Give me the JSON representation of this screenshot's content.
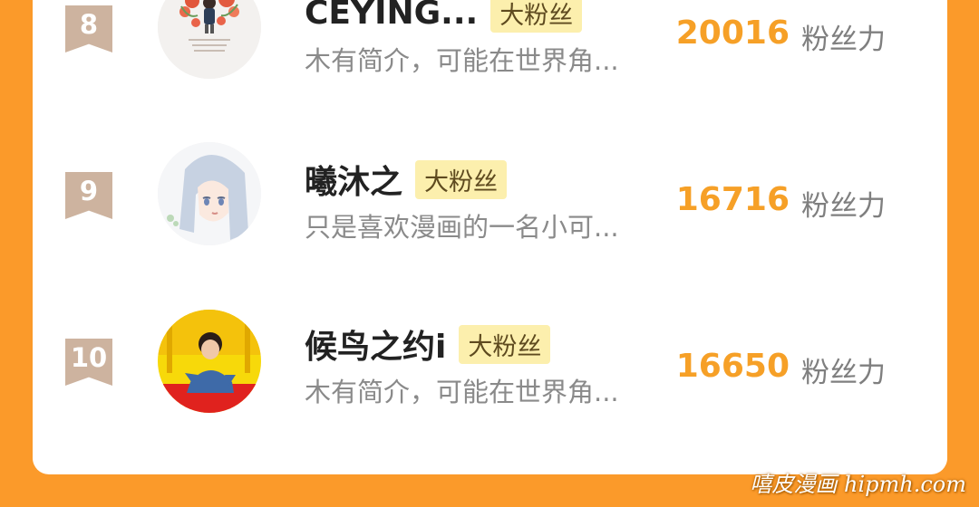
{
  "ranking": [
    {
      "rank": "8",
      "name": "CEYING...",
      "badge": "大粉丝",
      "intro": "木有简介，可能在世界角...",
      "score": "20016",
      "score_unit": "粉丝力",
      "avatar_icon": "flower-girl-avatar"
    },
    {
      "rank": "9",
      "name": "曦沐之",
      "badge": "大粉丝",
      "intro": "只是喜欢漫画的一名小可...",
      "score": "16716",
      "score_unit": "粉丝力",
      "avatar_icon": "anime-girl-avatar"
    },
    {
      "rank": "10",
      "name": "候鸟之约i",
      "badge": "大粉丝",
      "intro": "木有简介，可能在世界角...",
      "score": "16650",
      "score_unit": "粉丝力",
      "avatar_icon": "boy-photo-avatar"
    }
  ],
  "watermark": "嘻皮漫画 hipmh.com",
  "colors": {
    "background": "#fb9a2a",
    "card": "#ffffff",
    "score": "#f6a027",
    "badge_bg": "#fcefad",
    "rank_bg": "#cdb39f"
  }
}
